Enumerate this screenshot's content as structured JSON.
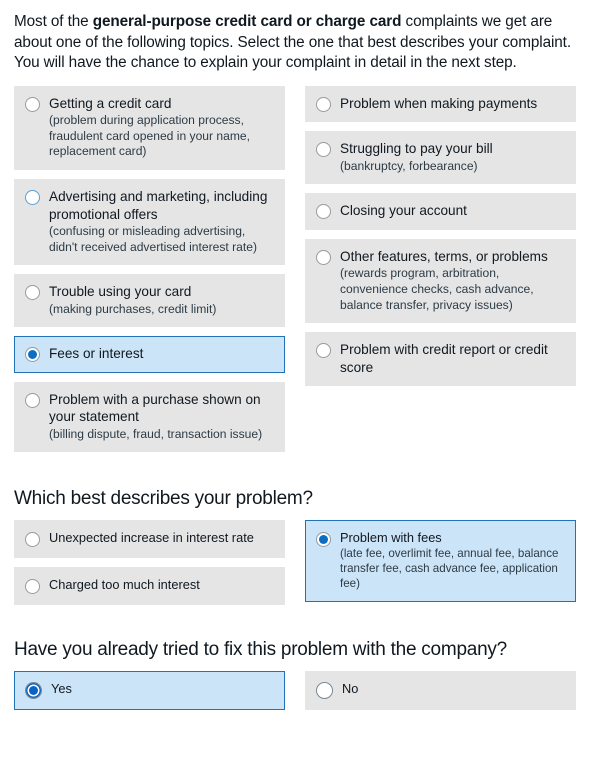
{
  "intro": {
    "lead": "Most of the ",
    "bold": "general-purpose credit card or charge card",
    "tail": " complaints we get are about one of the following topics. Select the one that best describes your complaint. You will have the chance to explain your complaint in detail in the next step."
  },
  "colors": {
    "card_background": "#e5e5e5",
    "selected_background": "#cce4f7",
    "selected_border": "#2272b8",
    "radio_fill": "#0b6ec4",
    "text": "#101820"
  },
  "topic_question": {
    "left_options": [
      {
        "title": "Getting a credit card",
        "sub": "(problem during application process, fraudulent card opened in your name, replacement card)",
        "state": "unselected"
      },
      {
        "title": "Advertising and marketing, including promotional offers",
        "sub": "(confusing or misleading advertising, didn't received advertised interest rate)",
        "state": "focused"
      },
      {
        "title": "Trouble using your card",
        "sub": "(making purchases, credit limit)",
        "state": "unselected"
      },
      {
        "title": "Fees or interest",
        "sub": "",
        "state": "selected"
      },
      {
        "title": "Problem with a purchase shown on your statement",
        "sub": "(billing dispute, fraud, transaction issue)",
        "state": "unselected"
      }
    ],
    "right_options": [
      {
        "title": "Problem when making payments",
        "sub": "",
        "state": "unselected"
      },
      {
        "title": "Struggling to pay your bill",
        "sub": "(bankruptcy, forbearance)",
        "state": "unselected"
      },
      {
        "title": "Closing your account",
        "sub": "",
        "state": "unselected"
      },
      {
        "title": "Other features, terms, or problems",
        "sub": "(rewards program, arbitration, convenience checks, cash advance, balance transfer, privacy issues)",
        "state": "unselected"
      },
      {
        "title": "Problem with credit report or credit score",
        "sub": "",
        "state": "unselected"
      }
    ]
  },
  "problem_question": {
    "heading": "Which best describes your problem?",
    "left_options": [
      {
        "title": "Unexpected increase in interest rate",
        "sub": "",
        "state": "unselected"
      },
      {
        "title": "Charged too much interest",
        "sub": "",
        "state": "unselected"
      }
    ],
    "right_options": [
      {
        "title": "Problem with fees",
        "sub": "(late fee, overlimit fee, annual fee, balance transfer fee, cash advance fee, application fee)",
        "state": "selected"
      }
    ]
  },
  "tried_question": {
    "heading": "Have you already tried to fix this problem with the company?",
    "left_options": [
      {
        "title": "Yes",
        "sub": "",
        "state": "selected"
      }
    ],
    "right_options": [
      {
        "title": "No",
        "sub": "",
        "state": "unselected"
      }
    ]
  }
}
